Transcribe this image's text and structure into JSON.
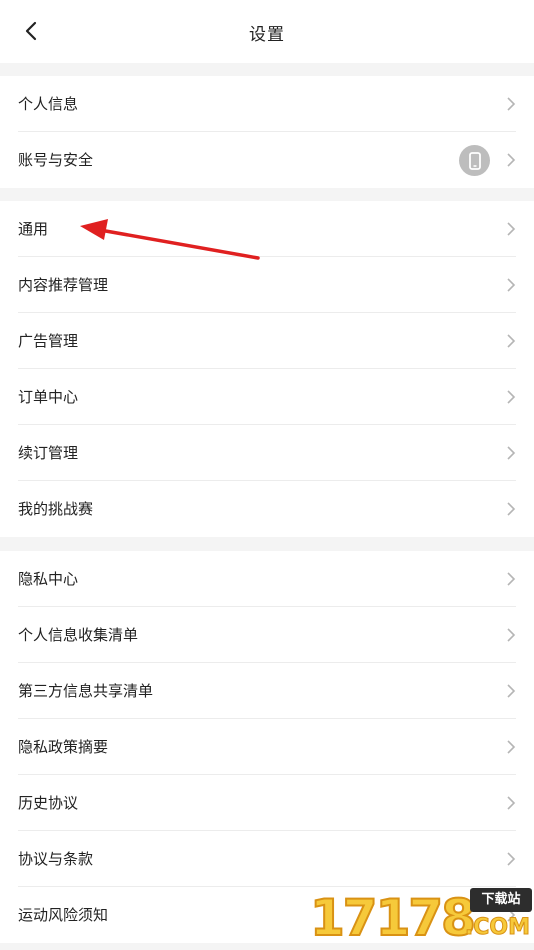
{
  "header": {
    "title": "设置",
    "back_icon": "chevron-left-icon"
  },
  "groups": [
    {
      "items": [
        {
          "label": "个人信息"
        },
        {
          "label": "账号与安全",
          "badge_icon": "phone-icon"
        }
      ]
    },
    {
      "items": [
        {
          "label": "通用"
        },
        {
          "label": "内容推荐管理"
        },
        {
          "label": "广告管理"
        },
        {
          "label": "订单中心"
        },
        {
          "label": "续订管理"
        },
        {
          "label": "我的挑战赛"
        }
      ]
    },
    {
      "items": [
        {
          "label": "隐私中心"
        },
        {
          "label": "个人信息收集清单"
        },
        {
          "label": "第三方信息共享清单"
        },
        {
          "label": "隐私政策摘要"
        },
        {
          "label": "历史协议"
        },
        {
          "label": "协议与条款"
        },
        {
          "label": "运动风险须知"
        }
      ]
    }
  ],
  "annotation": {
    "arrow_color": "#e02020"
  },
  "watermark": {
    "number": "17178",
    "tag": "下载站",
    "domain": ".COM"
  },
  "colors": {
    "background": "#f4f4f4",
    "row_bg": "#ffffff",
    "text": "#222222",
    "chevron": "#b5b5b5",
    "badge": "#bdbdbd"
  }
}
